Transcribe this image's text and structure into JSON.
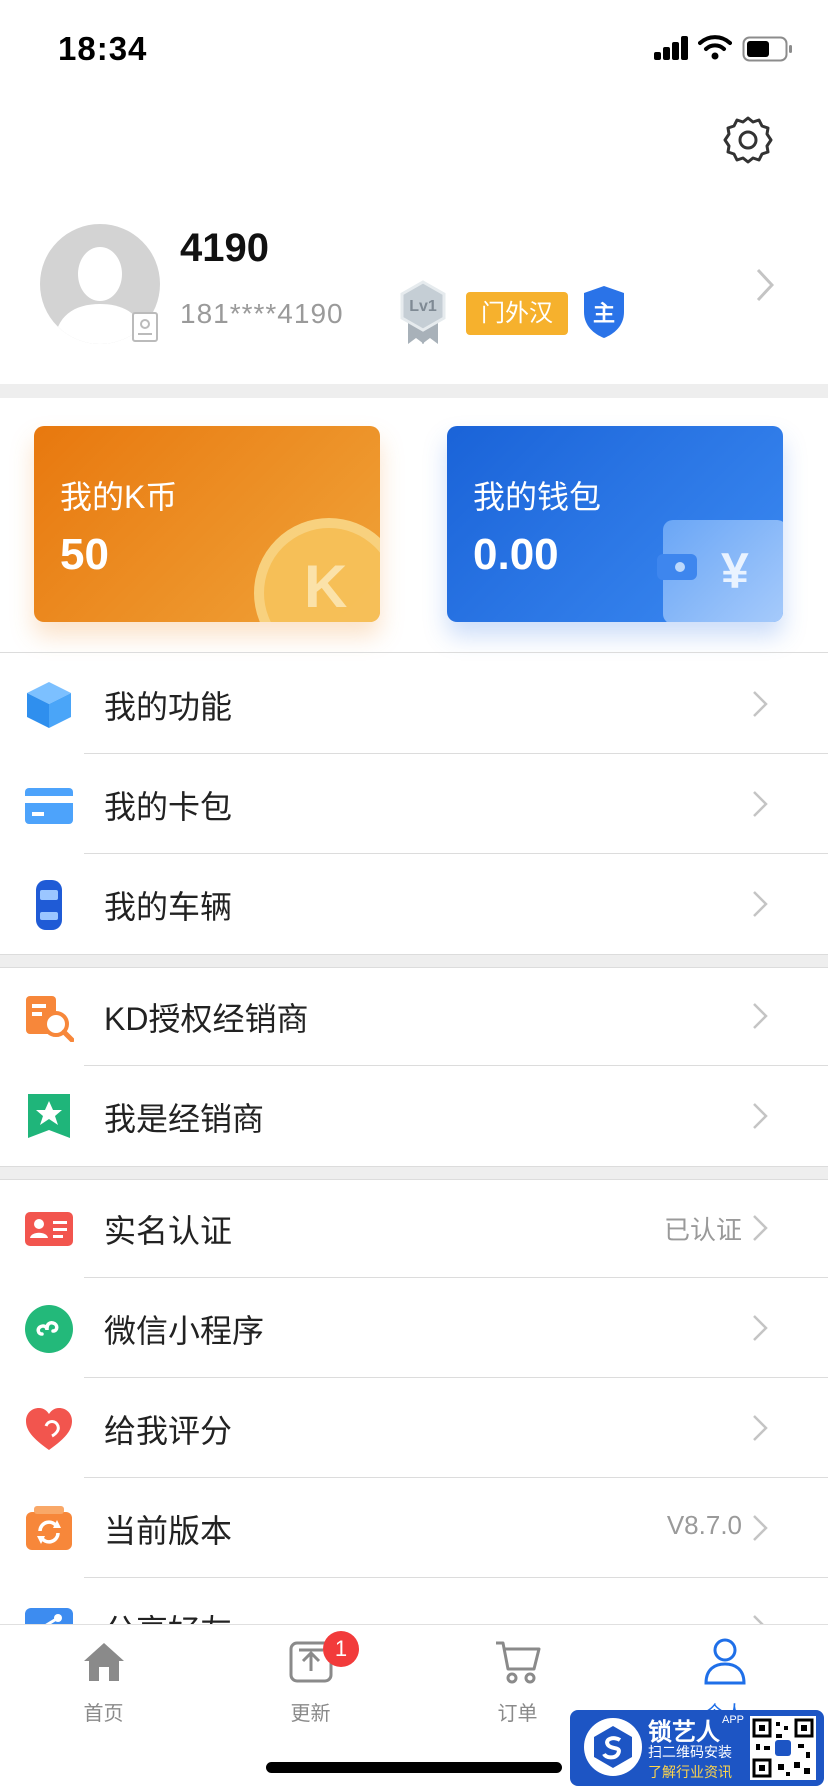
{
  "status_bar": {
    "time": "18:34"
  },
  "profile": {
    "name": "4190",
    "phone": "181****4190",
    "level_badge": "Lv1",
    "title_badge": "门外汉",
    "owner_badge": "主"
  },
  "cards": {
    "kcoin": {
      "title": "我的K币",
      "value": "50",
      "coin_letter": "K"
    },
    "wallet": {
      "title": "我的钱包",
      "value": "0.00",
      "currency_symbol": "¥"
    }
  },
  "menu": {
    "group1": [
      {
        "label": "我的功能",
        "icon": "cube-icon"
      },
      {
        "label": "我的卡包",
        "icon": "card-icon"
      },
      {
        "label": "我的车辆",
        "icon": "car-icon"
      }
    ],
    "group2": [
      {
        "label": "KD授权经销商",
        "icon": "certified-search-icon"
      },
      {
        "label": "我是经销商",
        "icon": "star-badge-icon"
      }
    ],
    "group3": [
      {
        "label": "实名认证",
        "value": "已认证",
        "icon": "id-card-icon"
      },
      {
        "label": "微信小程序",
        "icon": "mini-program-icon"
      },
      {
        "label": "给我评分",
        "icon": "heart-icon"
      },
      {
        "label": "当前版本",
        "value": "V8.7.0",
        "icon": "refresh-icon"
      },
      {
        "label": "分享好友",
        "icon": "share-icon"
      }
    ]
  },
  "tabbar": {
    "items": [
      {
        "label": "首页",
        "icon": "home-icon"
      },
      {
        "label": "更新",
        "icon": "upload-icon",
        "badge": "1"
      },
      {
        "label": "订单",
        "icon": "cart-icon"
      },
      {
        "label": "个人",
        "icon": "person-icon"
      }
    ]
  },
  "watermark": {
    "brand": "锁艺人",
    "superscript": "APP",
    "line1": "扫二维码安装",
    "line2": "了解行业资讯"
  },
  "colors": {
    "accent_blue": "#1f6fe8",
    "kcoin_orange": "#f08a1c",
    "badge_orange": "#f6b12d",
    "separator": "#eeeeee"
  }
}
